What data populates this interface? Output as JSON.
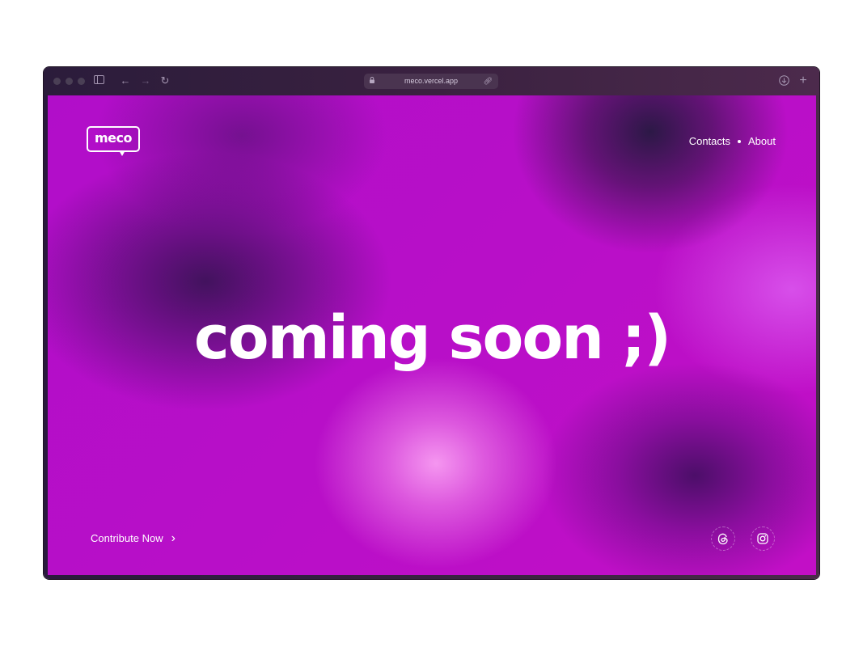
{
  "browser": {
    "address": "meco.vercel.app"
  },
  "header": {
    "logo_text": "meco",
    "nav": {
      "contacts": "Contacts",
      "about": "About"
    }
  },
  "hero": {
    "headline": "coming soon ;)"
  },
  "footer": {
    "contribute_label": "Contribute Now",
    "social_icons": [
      "threads-icon",
      "instagram-icon"
    ]
  },
  "colors": {
    "accent": "#b80fc8",
    "highlight": "#f596f0",
    "shadow": "#2c1846"
  }
}
